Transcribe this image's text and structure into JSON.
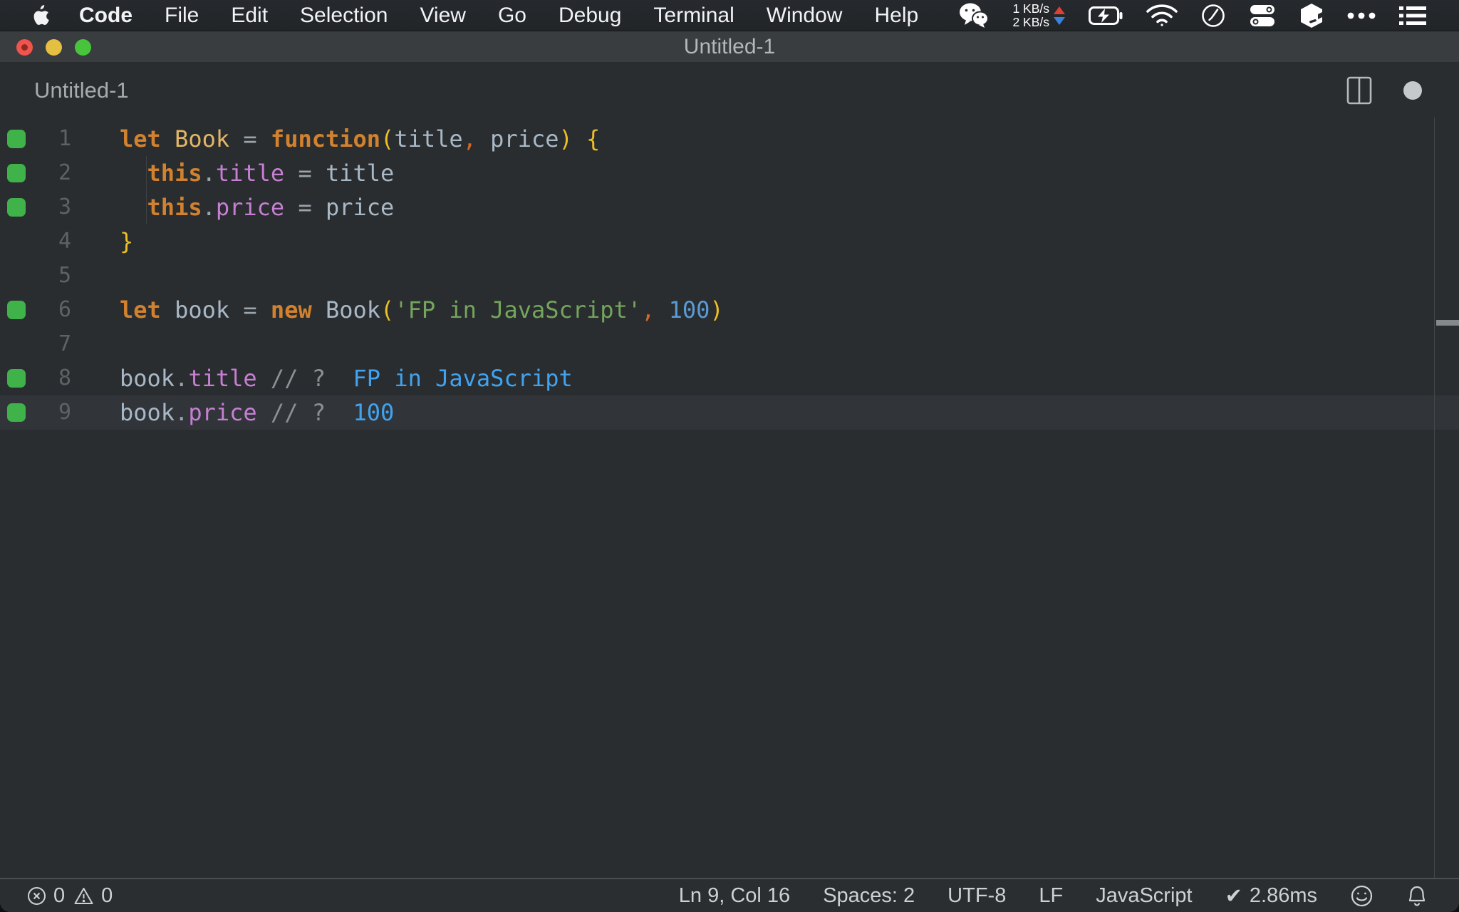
{
  "menubar": {
    "items": [
      {
        "label": "Code",
        "bold": true
      },
      {
        "label": "File"
      },
      {
        "label": "Edit"
      },
      {
        "label": "Selection"
      },
      {
        "label": "View"
      },
      {
        "label": "Go"
      },
      {
        "label": "Debug"
      },
      {
        "label": "Terminal"
      },
      {
        "label": "Window"
      },
      {
        "label": "Help"
      }
    ],
    "network": {
      "up": "1 KB/s",
      "down": "2 KB/s",
      "up_arrow_color": "#dd4034",
      "down_arrow_color": "#3b82de"
    },
    "icons": [
      "wechat-icon",
      "battery-charging-icon",
      "wifi-icon",
      "clock-icon",
      "toggles-icon",
      "cube-icon",
      "ellipsis-icon",
      "list-icon"
    ]
  },
  "window_title": "Untitled-1",
  "tab": {
    "label": "Untitled-1"
  },
  "editor": {
    "marker_color": "#3fb24a",
    "background": "#2a2d2f",
    "current_line_background": "#31353a",
    "syntax_colors": {
      "kw": "#d2822f",
      "cls": "#e3b567",
      "var": "#a9b8c6",
      "op": "#9aa5ad",
      "prop": "#c77fd4",
      "cm": "#d2692a",
      "br": "#edbf24",
      "str": "#74a55c",
      "num": "#5a9bd5",
      "cmt": "#8b9095",
      "res": "#41a3ef",
      "pl": "#abb2bf"
    },
    "lines": [
      {
        "num": "1",
        "marker": true,
        "segments": [
          [
            "let",
            "kw"
          ],
          [
            " ",
            "pl"
          ],
          [
            "Book",
            "cls"
          ],
          [
            " = ",
            "op"
          ],
          [
            "function",
            "kw"
          ],
          [
            "(",
            "br"
          ],
          [
            "title",
            "var"
          ],
          [
            ",",
            "cm"
          ],
          [
            " ",
            "pl"
          ],
          [
            "price",
            "var"
          ],
          [
            ")",
            "br"
          ],
          [
            " ",
            "pl"
          ],
          [
            "{",
            "br"
          ]
        ]
      },
      {
        "num": "2",
        "marker": true,
        "segments": [
          [
            "  ",
            "pl"
          ],
          [
            "this",
            "kw"
          ],
          [
            ".",
            "op"
          ],
          [
            "title",
            "prop"
          ],
          [
            " = ",
            "op"
          ],
          [
            "title",
            "var"
          ]
        ]
      },
      {
        "num": "3",
        "marker": true,
        "segments": [
          [
            "  ",
            "pl"
          ],
          [
            "this",
            "kw"
          ],
          [
            ".",
            "op"
          ],
          [
            "price",
            "prop"
          ],
          [
            " = ",
            "op"
          ],
          [
            "price",
            "var"
          ]
        ]
      },
      {
        "num": "4",
        "marker": false,
        "segments": [
          [
            "}",
            "br"
          ]
        ]
      },
      {
        "num": "5",
        "marker": false,
        "segments": []
      },
      {
        "num": "6",
        "marker": true,
        "segments": [
          [
            "let",
            "kw"
          ],
          [
            " ",
            "pl"
          ],
          [
            "book",
            "var"
          ],
          [
            " = ",
            "op"
          ],
          [
            "new",
            "kw"
          ],
          [
            " ",
            "pl"
          ],
          [
            "Book",
            "var"
          ],
          [
            "(",
            "br"
          ],
          [
            "'FP in JavaScript'",
            "str"
          ],
          [
            ",",
            "cm"
          ],
          [
            " ",
            "pl"
          ],
          [
            "100",
            "num"
          ],
          [
            ")",
            "br"
          ]
        ]
      },
      {
        "num": "7",
        "marker": false,
        "segments": []
      },
      {
        "num": "8",
        "marker": true,
        "segments": [
          [
            "book",
            "var"
          ],
          [
            ".",
            "op"
          ],
          [
            "title",
            "prop"
          ],
          [
            " ",
            "pl"
          ],
          [
            "// ?",
            "cmt"
          ],
          [
            "  FP in JavaScript",
            "res"
          ]
        ]
      },
      {
        "num": "9",
        "marker": true,
        "current": true,
        "segments": [
          [
            "book",
            "var"
          ],
          [
            ".",
            "op"
          ],
          [
            "price",
            "prop"
          ],
          [
            " ",
            "pl"
          ],
          [
            "// ?",
            "cmt"
          ],
          [
            "  100",
            "res"
          ]
        ]
      }
    ]
  },
  "statusbar": {
    "errors": "0",
    "warnings": "0",
    "right_items": [
      {
        "name": "cursor-position",
        "label": "Ln 9, Col 16"
      },
      {
        "name": "indentation",
        "label": "Spaces: 2"
      },
      {
        "name": "encoding",
        "label": "UTF-8"
      },
      {
        "name": "eol",
        "label": "LF"
      },
      {
        "name": "language-mode",
        "label": "JavaScript"
      }
    ],
    "check_icon": "✔",
    "perf_time": "2.86ms"
  }
}
